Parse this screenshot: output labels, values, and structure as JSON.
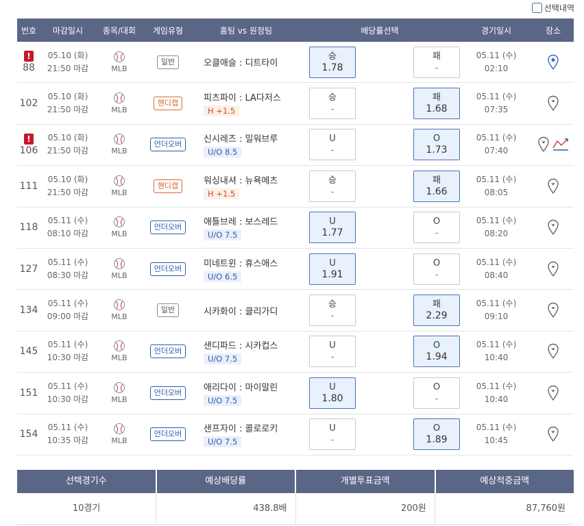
{
  "top": {
    "select_label": "선택내역"
  },
  "header": [
    "번호",
    "마감일시",
    "종목/대회",
    "게임유형",
    "홈팀 vs 원정팀",
    "배당률선택",
    "경기일시",
    "장소"
  ],
  "rows": [
    {
      "no": "88",
      "warn": true,
      "deadline_date": "05.10 (화)",
      "deadline_time": "21:50 마감",
      "league": "MLB",
      "type": "일반",
      "type_kind": "normal",
      "match": "오클애슬 : 디트타이",
      "handicap": "",
      "handi_kind": "",
      "left_label": "승",
      "left_value": "1.78",
      "left_sel": true,
      "right_label": "패",
      "right_value": "-",
      "right_sel": false,
      "game_date": "05.11 (수)",
      "game_time": "02:10",
      "venue": "pin-star",
      "chart": false
    },
    {
      "no": "102",
      "warn": false,
      "deadline_date": "05.10 (화)",
      "deadline_time": "21:50 마감",
      "league": "MLB",
      "type": "핸디캡",
      "type_kind": "hc",
      "match": "피츠파이 : LA다저스",
      "handicap": "H +1.5",
      "handi_kind": "h",
      "left_label": "승",
      "left_value": "-",
      "left_sel": false,
      "right_label": "패",
      "right_value": "1.68",
      "right_sel": true,
      "game_date": "05.11 (수)",
      "game_time": "07:35",
      "venue": "pin",
      "chart": false
    },
    {
      "no": "106",
      "warn": true,
      "deadline_date": "05.10 (화)",
      "deadline_time": "21:50 마감",
      "league": "MLB",
      "type": "언더오버",
      "type_kind": "ou",
      "match": "신시레즈 : 밀워브루",
      "handicap": "U/O 8.5",
      "handi_kind": "ou",
      "left_label": "U",
      "left_value": "-",
      "left_sel": false,
      "right_label": "O",
      "right_value": "1.73",
      "right_sel": true,
      "game_date": "05.11 (수)",
      "game_time": "07:40",
      "venue": "pin",
      "chart": true
    },
    {
      "no": "111",
      "warn": false,
      "deadline_date": "05.10 (화)",
      "deadline_time": "21:50 마감",
      "league": "MLB",
      "type": "핸디캡",
      "type_kind": "hc",
      "match": "워싱내셔 : 뉴욕메츠",
      "handicap": "H +1.5",
      "handi_kind": "h",
      "left_label": "승",
      "left_value": "-",
      "left_sel": false,
      "right_label": "패",
      "right_value": "1.66",
      "right_sel": true,
      "game_date": "05.11 (수)",
      "game_time": "08:05",
      "venue": "pin",
      "chart": false
    },
    {
      "no": "118",
      "warn": false,
      "deadline_date": "05.11 (수)",
      "deadline_time": "08:10 마감",
      "league": "MLB",
      "type": "언더오버",
      "type_kind": "ou",
      "match": "애틀브레 : 보스레드",
      "handicap": "U/O 7.5",
      "handi_kind": "ou",
      "left_label": "U",
      "left_value": "1.77",
      "left_sel": true,
      "right_label": "O",
      "right_value": "-",
      "right_sel": false,
      "game_date": "05.11 (수)",
      "game_time": "08:20",
      "venue": "pin",
      "chart": false
    },
    {
      "no": "127",
      "warn": false,
      "deadline_date": "05.11 (수)",
      "deadline_time": "08:30 마감",
      "league": "MLB",
      "type": "언더오버",
      "type_kind": "ou",
      "match": "미네트윈 : 휴스애스",
      "handicap": "U/O 6.5",
      "handi_kind": "ou",
      "left_label": "U",
      "left_value": "1.91",
      "left_sel": true,
      "right_label": "O",
      "right_value": "-",
      "right_sel": false,
      "game_date": "05.11 (수)",
      "game_time": "08:40",
      "venue": "pin",
      "chart": false
    },
    {
      "no": "134",
      "warn": false,
      "deadline_date": "05.11 (수)",
      "deadline_time": "09:00 마감",
      "league": "MLB",
      "type": "일반",
      "type_kind": "normal",
      "match": "시카화이 : 클리가디",
      "handicap": "",
      "handi_kind": "",
      "left_label": "승",
      "left_value": "-",
      "left_sel": false,
      "right_label": "패",
      "right_value": "2.29",
      "right_sel": true,
      "game_date": "05.11 (수)",
      "game_time": "09:10",
      "venue": "pin",
      "chart": false
    },
    {
      "no": "145",
      "warn": false,
      "deadline_date": "05.11 (수)",
      "deadline_time": "10:30 마감",
      "league": "MLB",
      "type": "언더오버",
      "type_kind": "ou",
      "match": "샌디파드 : 시카컵스",
      "handicap": "U/O 7.5",
      "handi_kind": "ou",
      "left_label": "U",
      "left_value": "-",
      "left_sel": false,
      "right_label": "O",
      "right_value": "1.94",
      "right_sel": true,
      "game_date": "05.11 (수)",
      "game_time": "10:40",
      "venue": "pin",
      "chart": false
    },
    {
      "no": "151",
      "warn": false,
      "deadline_date": "05.11 (수)",
      "deadline_time": "10:30 마감",
      "league": "MLB",
      "type": "언더오버",
      "type_kind": "ou",
      "match": "애리다이 : 마이말린",
      "handicap": "U/O 7.5",
      "handi_kind": "ou",
      "left_label": "U",
      "left_value": "1.80",
      "left_sel": true,
      "right_label": "O",
      "right_value": "-",
      "right_sel": false,
      "game_date": "05.11 (수)",
      "game_time": "10:40",
      "venue": "pin",
      "chart": false
    },
    {
      "no": "154",
      "warn": false,
      "deadline_date": "05.11 (수)",
      "deadline_time": "10:35 마감",
      "league": "MLB",
      "type": "언더오버",
      "type_kind": "ou",
      "match": "샌프자이 : 콜로로키",
      "handicap": "U/O 7.5",
      "handi_kind": "ou",
      "left_label": "U",
      "left_value": "-",
      "left_sel": false,
      "right_label": "O",
      "right_value": "1.89",
      "right_sel": true,
      "game_date": "05.11 (수)",
      "game_time": "10:45",
      "venue": "pin",
      "chart": false
    }
  ],
  "summary": {
    "headers": [
      "선택경기수",
      "예상배당률",
      "개별투표금액",
      "예상적중금액"
    ],
    "values": [
      "10경기",
      "438.8배",
      "200원",
      "87,760원"
    ]
  },
  "colors": {
    "header_bg": "#5a6686",
    "selected_bg": "#e8f1fc",
    "selected_border": "#4a72b6",
    "warn": "#c7172c",
    "handicap": "#d4692f",
    "underover": "#2d5aa8"
  }
}
